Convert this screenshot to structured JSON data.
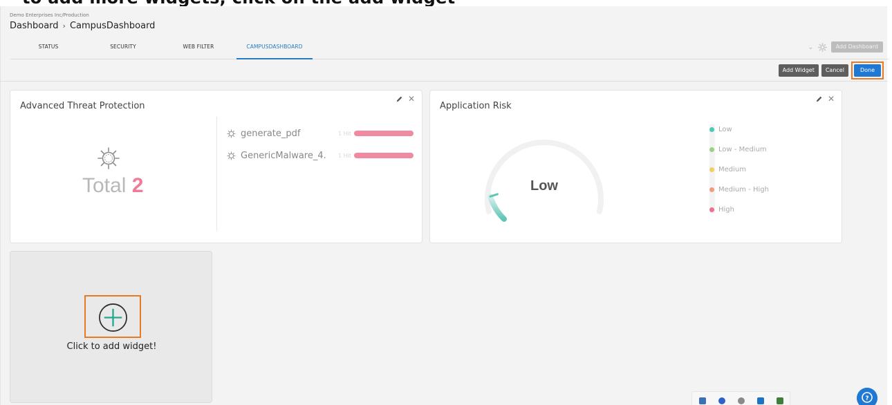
{
  "top_banner": {
    "text": "to add more widgets, click on the add widget"
  },
  "header": {
    "org": "Demo Enterprises Inc/Production",
    "breadcrumb": [
      "Dashboard",
      "CampusDashboard"
    ],
    "breadcrumb_sep": "›"
  },
  "tabs": [
    {
      "label": "STATUS"
    },
    {
      "label": "SECURITY"
    },
    {
      "label": "WEB FILTER"
    },
    {
      "label": "CAMPUSDASHBOARD",
      "active": true
    }
  ],
  "toolbar": {
    "add_dashboard": "Add Dashboard",
    "add_widget": "Add Widget",
    "cancel": "Cancel",
    "done": "Done"
  },
  "atp_widget": {
    "title": "Advanced Threat Protection",
    "total_label": "Total",
    "total_value": "2",
    "threats": [
      {
        "name": "generate_pdf",
        "hits": "1 Hit",
        "hit_fraction": 1.0
      },
      {
        "name": "GenericMalware_4.",
        "hits": "1 Hit",
        "hit_fraction": 1.0
      }
    ]
  },
  "app_risk_widget": {
    "title": "Application Risk",
    "gauge_value": "Low",
    "gauge_fraction": 0.1,
    "legend": [
      {
        "label": "Low",
        "color": "#4dc8b8"
      },
      {
        "label": "Low - Medium",
        "color": "#9ccf8a"
      },
      {
        "label": "Medium",
        "color": "#f2cf5d"
      },
      {
        "label": "Medium - High",
        "color": "#f29a7a"
      },
      {
        "label": "High",
        "color": "#ef6f8f"
      }
    ]
  },
  "add_widget_card": {
    "label": "Click to add widget!"
  },
  "colors": {
    "accent_blue": "#1f79d4",
    "highlight_orange": "#e77b24",
    "threat_pink": "#ef7b97",
    "gauge_teal": "#4dc8b8"
  },
  "icons": {
    "help": "help-circle-icon",
    "settings": "gear-icon",
    "threat": "virus-icon"
  }
}
